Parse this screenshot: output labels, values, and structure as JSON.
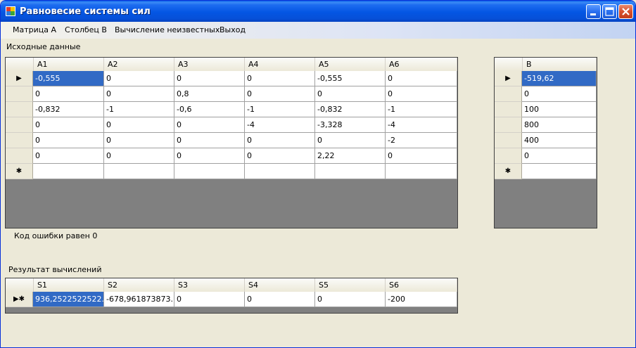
{
  "window": {
    "title": "Равновесие системы сил"
  },
  "menu": [
    {
      "label": "Матрица А"
    },
    {
      "label": "Столбец В"
    },
    {
      "label": "Вычисление неизвестных"
    },
    {
      "label": "Выход"
    }
  ],
  "matrix_a": {
    "caption": "Исходные данные",
    "columns": [
      "A1",
      "A2",
      "A3",
      "A4",
      "A5",
      "A6"
    ],
    "rows": [
      [
        "-0,555",
        "0",
        "0",
        "0",
        "-0,555",
        "0"
      ],
      [
        "0",
        "0",
        "0,8",
        "0",
        "0",
        "0"
      ],
      [
        "-0,832",
        "-1",
        "-0,6",
        "-1",
        "-0,832",
        "-1"
      ],
      [
        "0",
        "0",
        "0",
        "-4",
        "-3,328",
        "-4"
      ],
      [
        "0",
        "0",
        "0",
        "0",
        "0",
        "-2"
      ],
      [
        "0",
        "0",
        "0",
        "0",
        "2,22",
        "0"
      ]
    ],
    "current_row_marker": "▶",
    "new_row_marker": "✱"
  },
  "vector_b": {
    "columns": [
      "B"
    ],
    "rows": [
      [
        "-519,62"
      ],
      [
        "0"
      ],
      [
        "100"
      ],
      [
        "800"
      ],
      [
        "400"
      ],
      [
        "0"
      ]
    ],
    "current_row_marker": "▶",
    "new_row_marker": "✱"
  },
  "error": {
    "text": "Код ошибки равен 0"
  },
  "result": {
    "caption": "Результат вычислений",
    "columns": [
      "S1",
      "S2",
      "S3",
      "S4",
      "S5",
      "S6"
    ],
    "rows": [
      [
        "936,2522522522...",
        "-678,961873873...",
        "0",
        "0",
        "0",
        "-200"
      ]
    ],
    "row_marker": "▶✱"
  },
  "colors": {
    "titlebar": "#0456e3",
    "selection": "#316ac5",
    "grid_background": "#808080",
    "window_background": "#ece9d8"
  },
  "icons": {
    "app": "app-icon",
    "minimize": "minimize-icon",
    "maximize": "maximize-icon",
    "close": "close-icon"
  }
}
